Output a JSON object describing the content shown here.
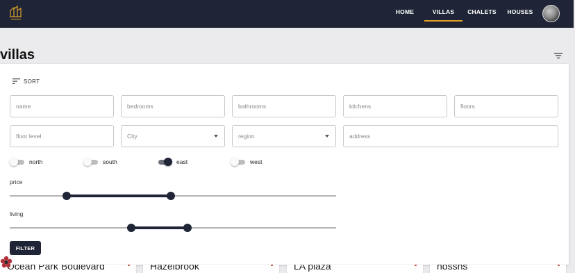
{
  "nav": {
    "logo": "logo-icon",
    "items": [
      {
        "label": "HOME"
      },
      {
        "label": "VILLAS",
        "active": true
      },
      {
        "label": "CHALETS"
      },
      {
        "label": "HOUSES"
      }
    ],
    "accent_color": "#e0a12a",
    "bar_color": "#1f2536"
  },
  "page": {
    "title": "villas",
    "filter_icon": "filter-list-icon"
  },
  "filters": {
    "sort_label": "SORT",
    "fields": {
      "name": "name",
      "bedrooms": "bedrooms",
      "bathrooms": "bathrooms",
      "kitchens": "kitchens",
      "floors": "floors",
      "floor_level": "floor level",
      "city": "City",
      "region": "region",
      "address": "address"
    },
    "directions": [
      {
        "label": "north",
        "on": false
      },
      {
        "label": "south",
        "on": false
      },
      {
        "label": "east",
        "on": true
      },
      {
        "label": "west",
        "on": false
      }
    ],
    "price": {
      "label": "price",
      "low_fraction": 0.175,
      "high_fraction": 0.493
    },
    "living": {
      "label": "living",
      "low_fraction": 0.373,
      "high_fraction": 0.545
    },
    "button_label": "FILTER"
  },
  "cards": [
    {
      "title": "Ocean Park Boulevard"
    },
    {
      "title": "Hazelbrook"
    },
    {
      "title": "LA plaza"
    },
    {
      "title": "hossns"
    }
  ]
}
